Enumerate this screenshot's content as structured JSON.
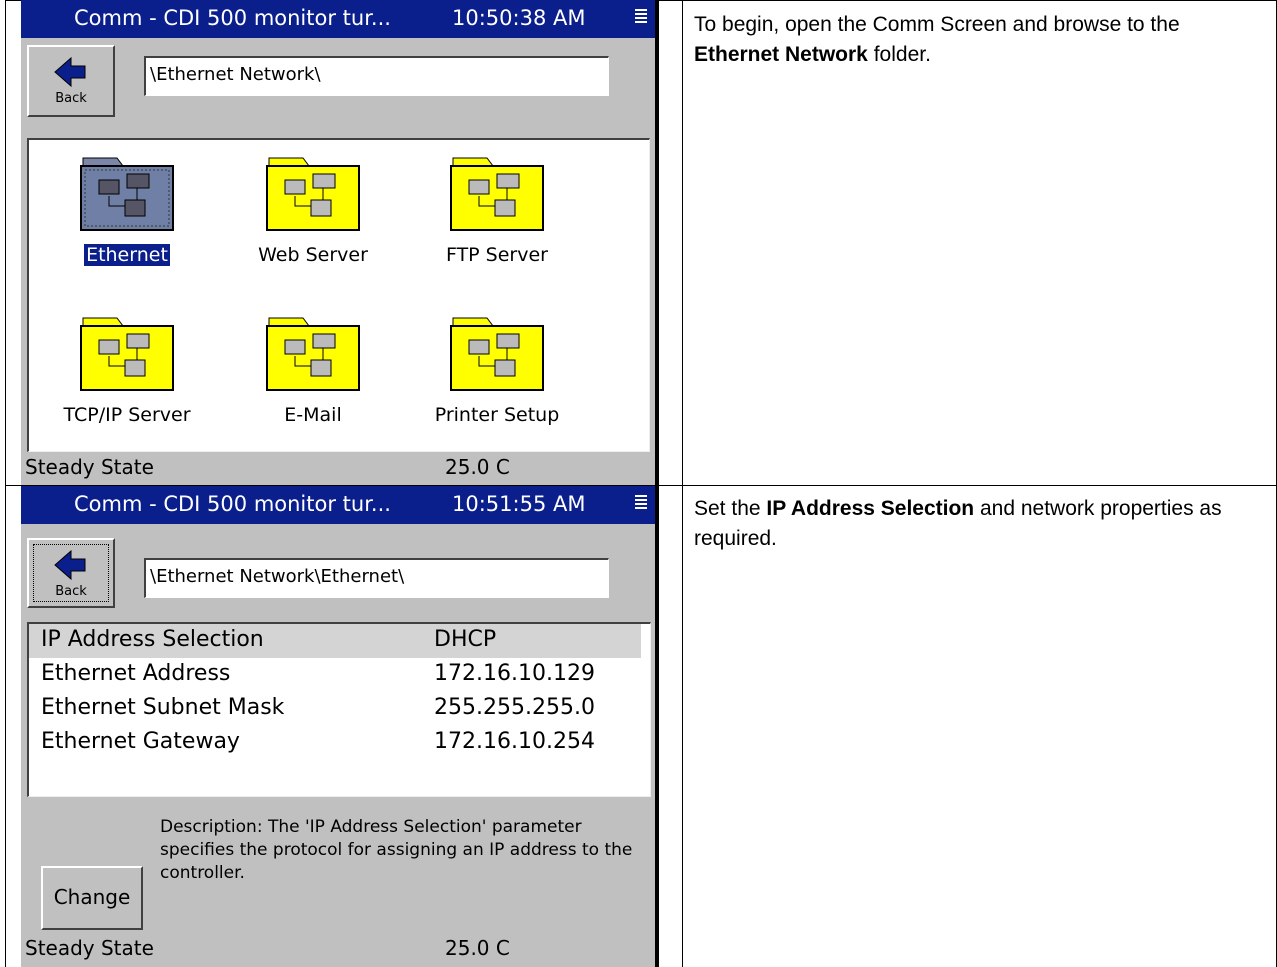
{
  "rows": [
    {
      "screen": {
        "title": "Comm - CDI 500 monitor tur...",
        "time": "10:50:38 AM",
        "back_label": "Back",
        "path": "\\Ethernet Network\\",
        "folders": [
          {
            "label": "Ethernet",
            "selected": true
          },
          {
            "label": "Web Server"
          },
          {
            "label": "FTP Server"
          },
          {
            "label": "TCP/IP Server"
          },
          {
            "label": "E-Mail"
          },
          {
            "label": "Printer Setup"
          }
        ],
        "status_left": "Steady State",
        "status_right": "25.0 C"
      },
      "note": {
        "before": "To begin, open the Comm Screen and browse to the ",
        "bold": "Ethernet Network",
        "after": " folder."
      }
    },
    {
      "screen": {
        "title": "Comm - CDI 500 monitor tur...",
        "time": "10:51:55 AM",
        "back_label": "Back",
        "path": "\\Ethernet Network\\Ethernet\\",
        "properties": [
          {
            "name": "IP Address Selection",
            "value": "DHCP",
            "selected": true
          },
          {
            "name": "Ethernet Address",
            "value": "172.16.10.129"
          },
          {
            "name": "Ethernet Subnet Mask",
            "value": "255.255.255.0"
          },
          {
            "name": "Ethernet Gateway",
            "value": "172.16.10.254"
          }
        ],
        "description": "Description:  The 'IP Address Selection' parameter specifies the protocol for assigning an IP address to the controller.",
        "change_label": "Change",
        "status_left": "Steady State",
        "status_right": "25.0 C"
      },
      "note": {
        "before": "Set the ",
        "bold": "IP Address Selection",
        "after": " and network properties as required."
      }
    }
  ],
  "colors": {
    "titlebar": "#0b1f8c",
    "folder_yellow": "#ffff00",
    "folder_selected": "#6b7aa0",
    "window_gray": "#c0c0c0"
  }
}
